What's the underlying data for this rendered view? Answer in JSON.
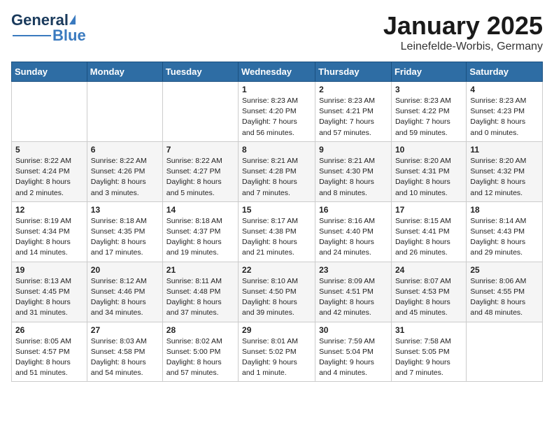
{
  "header": {
    "logo_general": "General",
    "logo_blue": "Blue",
    "title": "January 2025",
    "location": "Leinefelde-Worbis, Germany"
  },
  "weekdays": [
    "Sunday",
    "Monday",
    "Tuesday",
    "Wednesday",
    "Thursday",
    "Friday",
    "Saturday"
  ],
  "weeks": [
    [
      {
        "day": "",
        "info": ""
      },
      {
        "day": "",
        "info": ""
      },
      {
        "day": "",
        "info": ""
      },
      {
        "day": "1",
        "info": "Sunrise: 8:23 AM\nSunset: 4:20 PM\nDaylight: 7 hours\nand 56 minutes."
      },
      {
        "day": "2",
        "info": "Sunrise: 8:23 AM\nSunset: 4:21 PM\nDaylight: 7 hours\nand 57 minutes."
      },
      {
        "day": "3",
        "info": "Sunrise: 8:23 AM\nSunset: 4:22 PM\nDaylight: 7 hours\nand 59 minutes."
      },
      {
        "day": "4",
        "info": "Sunrise: 8:23 AM\nSunset: 4:23 PM\nDaylight: 8 hours\nand 0 minutes."
      }
    ],
    [
      {
        "day": "5",
        "info": "Sunrise: 8:22 AM\nSunset: 4:24 PM\nDaylight: 8 hours\nand 2 minutes."
      },
      {
        "day": "6",
        "info": "Sunrise: 8:22 AM\nSunset: 4:26 PM\nDaylight: 8 hours\nand 3 minutes."
      },
      {
        "day": "7",
        "info": "Sunrise: 8:22 AM\nSunset: 4:27 PM\nDaylight: 8 hours\nand 5 minutes."
      },
      {
        "day": "8",
        "info": "Sunrise: 8:21 AM\nSunset: 4:28 PM\nDaylight: 8 hours\nand 7 minutes."
      },
      {
        "day": "9",
        "info": "Sunrise: 8:21 AM\nSunset: 4:30 PM\nDaylight: 8 hours\nand 8 minutes."
      },
      {
        "day": "10",
        "info": "Sunrise: 8:20 AM\nSunset: 4:31 PM\nDaylight: 8 hours\nand 10 minutes."
      },
      {
        "day": "11",
        "info": "Sunrise: 8:20 AM\nSunset: 4:32 PM\nDaylight: 8 hours\nand 12 minutes."
      }
    ],
    [
      {
        "day": "12",
        "info": "Sunrise: 8:19 AM\nSunset: 4:34 PM\nDaylight: 8 hours\nand 14 minutes."
      },
      {
        "day": "13",
        "info": "Sunrise: 8:18 AM\nSunset: 4:35 PM\nDaylight: 8 hours\nand 17 minutes."
      },
      {
        "day": "14",
        "info": "Sunrise: 8:18 AM\nSunset: 4:37 PM\nDaylight: 8 hours\nand 19 minutes."
      },
      {
        "day": "15",
        "info": "Sunrise: 8:17 AM\nSunset: 4:38 PM\nDaylight: 8 hours\nand 21 minutes."
      },
      {
        "day": "16",
        "info": "Sunrise: 8:16 AM\nSunset: 4:40 PM\nDaylight: 8 hours\nand 24 minutes."
      },
      {
        "day": "17",
        "info": "Sunrise: 8:15 AM\nSunset: 4:41 PM\nDaylight: 8 hours\nand 26 minutes."
      },
      {
        "day": "18",
        "info": "Sunrise: 8:14 AM\nSunset: 4:43 PM\nDaylight: 8 hours\nand 29 minutes."
      }
    ],
    [
      {
        "day": "19",
        "info": "Sunrise: 8:13 AM\nSunset: 4:45 PM\nDaylight: 8 hours\nand 31 minutes."
      },
      {
        "day": "20",
        "info": "Sunrise: 8:12 AM\nSunset: 4:46 PM\nDaylight: 8 hours\nand 34 minutes."
      },
      {
        "day": "21",
        "info": "Sunrise: 8:11 AM\nSunset: 4:48 PM\nDaylight: 8 hours\nand 37 minutes."
      },
      {
        "day": "22",
        "info": "Sunrise: 8:10 AM\nSunset: 4:50 PM\nDaylight: 8 hours\nand 39 minutes."
      },
      {
        "day": "23",
        "info": "Sunrise: 8:09 AM\nSunset: 4:51 PM\nDaylight: 8 hours\nand 42 minutes."
      },
      {
        "day": "24",
        "info": "Sunrise: 8:07 AM\nSunset: 4:53 PM\nDaylight: 8 hours\nand 45 minutes."
      },
      {
        "day": "25",
        "info": "Sunrise: 8:06 AM\nSunset: 4:55 PM\nDaylight: 8 hours\nand 48 minutes."
      }
    ],
    [
      {
        "day": "26",
        "info": "Sunrise: 8:05 AM\nSunset: 4:57 PM\nDaylight: 8 hours\nand 51 minutes."
      },
      {
        "day": "27",
        "info": "Sunrise: 8:03 AM\nSunset: 4:58 PM\nDaylight: 8 hours\nand 54 minutes."
      },
      {
        "day": "28",
        "info": "Sunrise: 8:02 AM\nSunset: 5:00 PM\nDaylight: 8 hours\nand 57 minutes."
      },
      {
        "day": "29",
        "info": "Sunrise: 8:01 AM\nSunset: 5:02 PM\nDaylight: 9 hours\nand 1 minute."
      },
      {
        "day": "30",
        "info": "Sunrise: 7:59 AM\nSunset: 5:04 PM\nDaylight: 9 hours\nand 4 minutes."
      },
      {
        "day": "31",
        "info": "Sunrise: 7:58 AM\nSunset: 5:05 PM\nDaylight: 9 hours\nand 7 minutes."
      },
      {
        "day": "",
        "info": ""
      }
    ]
  ]
}
